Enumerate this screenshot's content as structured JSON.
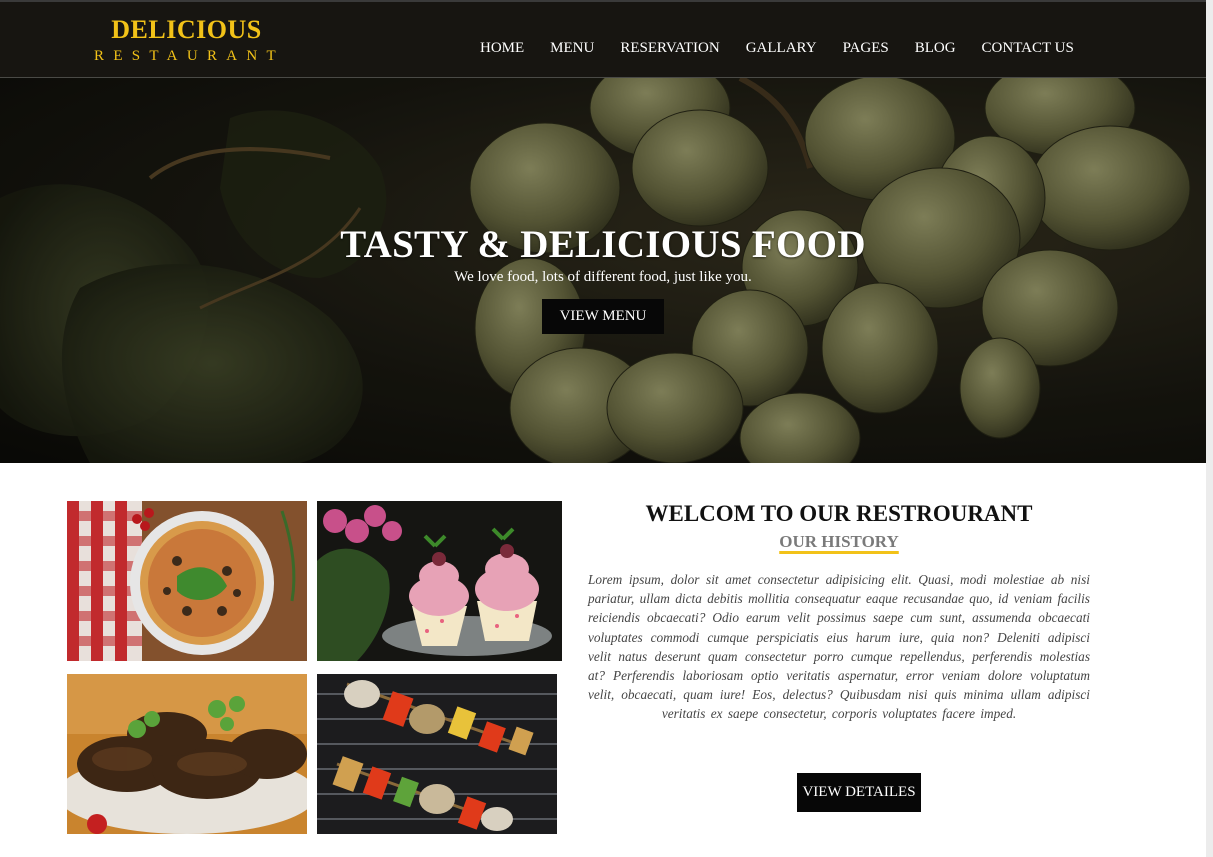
{
  "brand": {
    "title": "DELICIOUS",
    "subtitle": "RESTAURANT",
    "accent": "#f2c218"
  },
  "nav": {
    "items": [
      "HOME",
      "MENU",
      "RESERVATION",
      "GALLARY",
      "PAGES",
      "BLOG",
      "CONTACT US"
    ]
  },
  "hero": {
    "title": "TASTY & DELICIOUS FOOD",
    "subtitle": "We love food, lots of different food, just like you.",
    "button": "VIEW MENU"
  },
  "gallery": {
    "images": [
      "pizza",
      "cupcakes",
      "grilled-meat",
      "vegetable-skewers"
    ]
  },
  "welcome": {
    "title": "WELCOM TO OUR RESTROURANT",
    "history": "OUR HISTORY",
    "body": "Lorem ipsum, dolor sit amet consectetur adipisicing elit. Quasi, modi molestiae ab nisi pariatur, ullam dicta debitis mollitia consequatur eaque recusandae quo, id veniam facilis reiciendis obcaecati? Odio earum velit possimus saepe cum sunt, assumenda obcaecati voluptates commodi cumque perspiciatis eius harum iure, quia non? Deleniti adipisci velit natus deserunt quam consectetur porro cumque repellendus, perferendis molestias at? Perferendis laboriosam optio veritatis aspernatur, error veniam dolore voluptatum velit, obcaecati, quam iure! Eos, delectus? Quibusdam nisi quis minima ullam adipisci veritatis ex saepe consectetur, corporis voluptates facere imped.",
    "button": "VIEW DETAILES"
  }
}
